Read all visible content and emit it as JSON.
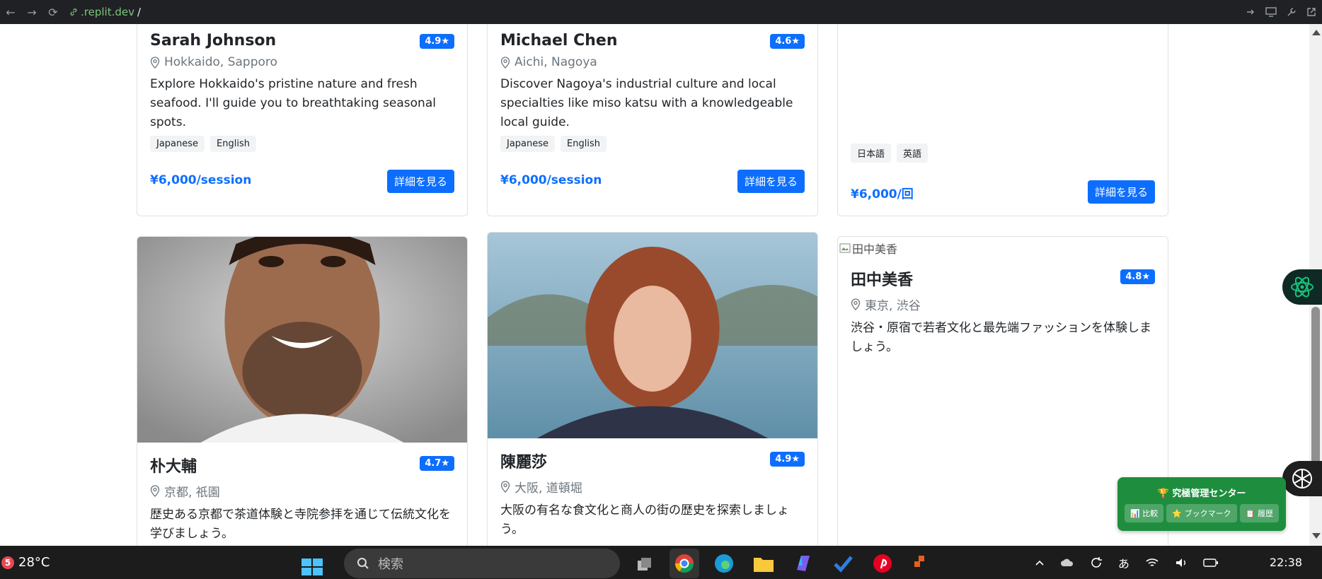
{
  "browser": {
    "url_host": ".replit.dev",
    "url_path": "/",
    "back_glyph": "←",
    "forward_glyph": "→",
    "reload_glyph": "⟳"
  },
  "guides_top": [
    {
      "name": "Sarah Johnson",
      "rating": "4.9★",
      "location": "Hokkaido, Sapporo",
      "description": "Explore Hokkaido's pristine nature and fresh seafood. I'll guide you to breathtaking seasonal spots.",
      "tags": [
        "Japanese",
        "English"
      ],
      "price": "¥6,000/session",
      "button": "詳細を見る"
    },
    {
      "name": "Michael Chen",
      "rating": "4.6★",
      "location": "Aichi, Nagoya",
      "description": "Discover Nagoya's industrial culture and local specialties like miso katsu with a knowledgeable local guide.",
      "tags": [
        "Japanese",
        "English"
      ],
      "price": "¥6,000/session",
      "button": "詳細を見る"
    },
    {
      "tags": [
        "日本語",
        "英語"
      ],
      "price": "¥6,000/回",
      "button": "詳細を見る"
    }
  ],
  "guides_bottom": [
    {
      "name": "朴大輔",
      "rating": "4.7★",
      "location": "京都, 祇園",
      "description": "歴史ある京都で茶道体験と寺院参拝を通じて伝統文化を学びましょう。"
    },
    {
      "name": "陳麗莎",
      "rating": "4.9★",
      "location": "大阪, 道頓堀",
      "description": "大阪の有名な食文化と商人の街の歴史を探索しましょう。"
    },
    {
      "alt": "田中美香",
      "name": "田中美香",
      "rating": "4.8★",
      "location": "東京, 渋谷",
      "description": "渋谷・原宿で若者文化と最先端ファッションを体験しましょう。"
    }
  ],
  "management": {
    "title": "🏆 究極管理センター",
    "compare": "📊 比較",
    "bookmark": "⭐ ブックマーク",
    "history": "📋 履歴"
  },
  "taskbar": {
    "weather_badge": "5",
    "temperature": "28°C",
    "search_placeholder": "検索",
    "ime": "あ",
    "clock": "22:38"
  },
  "colors": {
    "accent": "#0d6efd",
    "management_green": "#1e8e3e"
  }
}
